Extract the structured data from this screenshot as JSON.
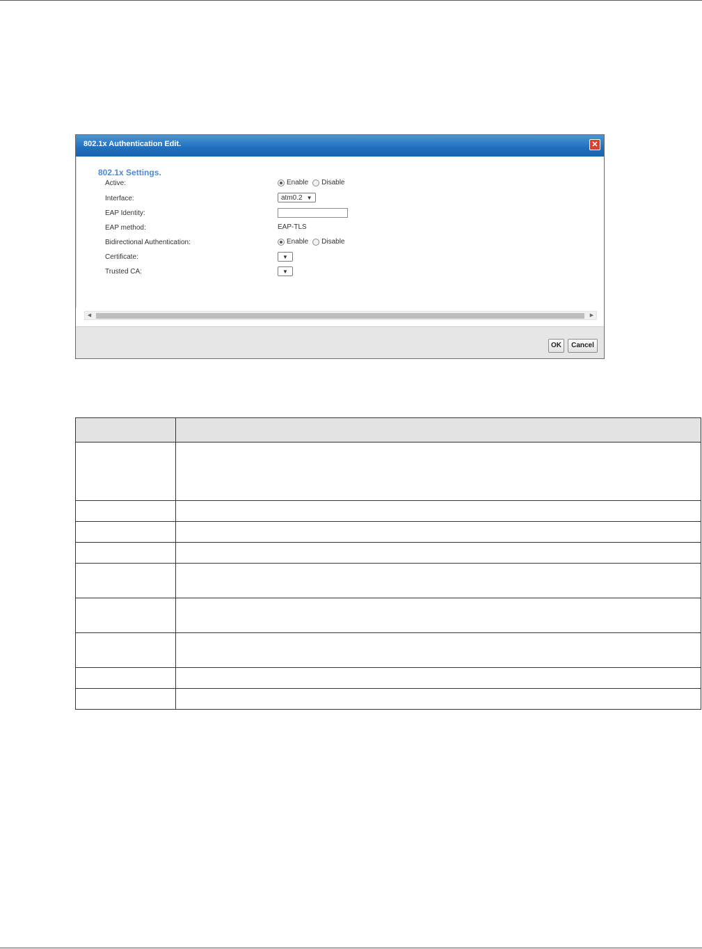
{
  "dialog": {
    "title": "802.1x Authentication Edit.",
    "close_glyph": "✕",
    "section_title": "802.1x Settings.",
    "fields": {
      "active": {
        "label": "Active:",
        "options": [
          "Enable",
          "Disable"
        ],
        "selected": "Enable"
      },
      "interface": {
        "label": "Interface:",
        "value": "atm0.2"
      },
      "eap_identity": {
        "label": "EAP Identity:",
        "value": ""
      },
      "eap_method": {
        "label": "EAP method:",
        "value": "EAP-TLS"
      },
      "bidirectional": {
        "label": "Bidirectional Authentication:",
        "options": [
          "Enable",
          "Disable"
        ],
        "selected": "Enable"
      },
      "certificate": {
        "label": "Certificate:",
        "value": ""
      },
      "trusted_ca": {
        "label": "Trusted CA:",
        "value": ""
      }
    },
    "buttons": {
      "ok": "OK",
      "cancel": "Cancel"
    },
    "caret_glyph": "▼",
    "scroll_left_glyph": "◀",
    "scroll_right_glyph": "▶"
  },
  "table": {
    "header": [
      "",
      ""
    ],
    "rows": [
      [
        "",
        ""
      ],
      [
        "",
        ""
      ],
      [
        "",
        ""
      ],
      [
        "",
        ""
      ],
      [
        "",
        ""
      ],
      [
        "",
        ""
      ],
      [
        "",
        ""
      ],
      [
        "",
        ""
      ],
      [
        "",
        ""
      ]
    ]
  }
}
